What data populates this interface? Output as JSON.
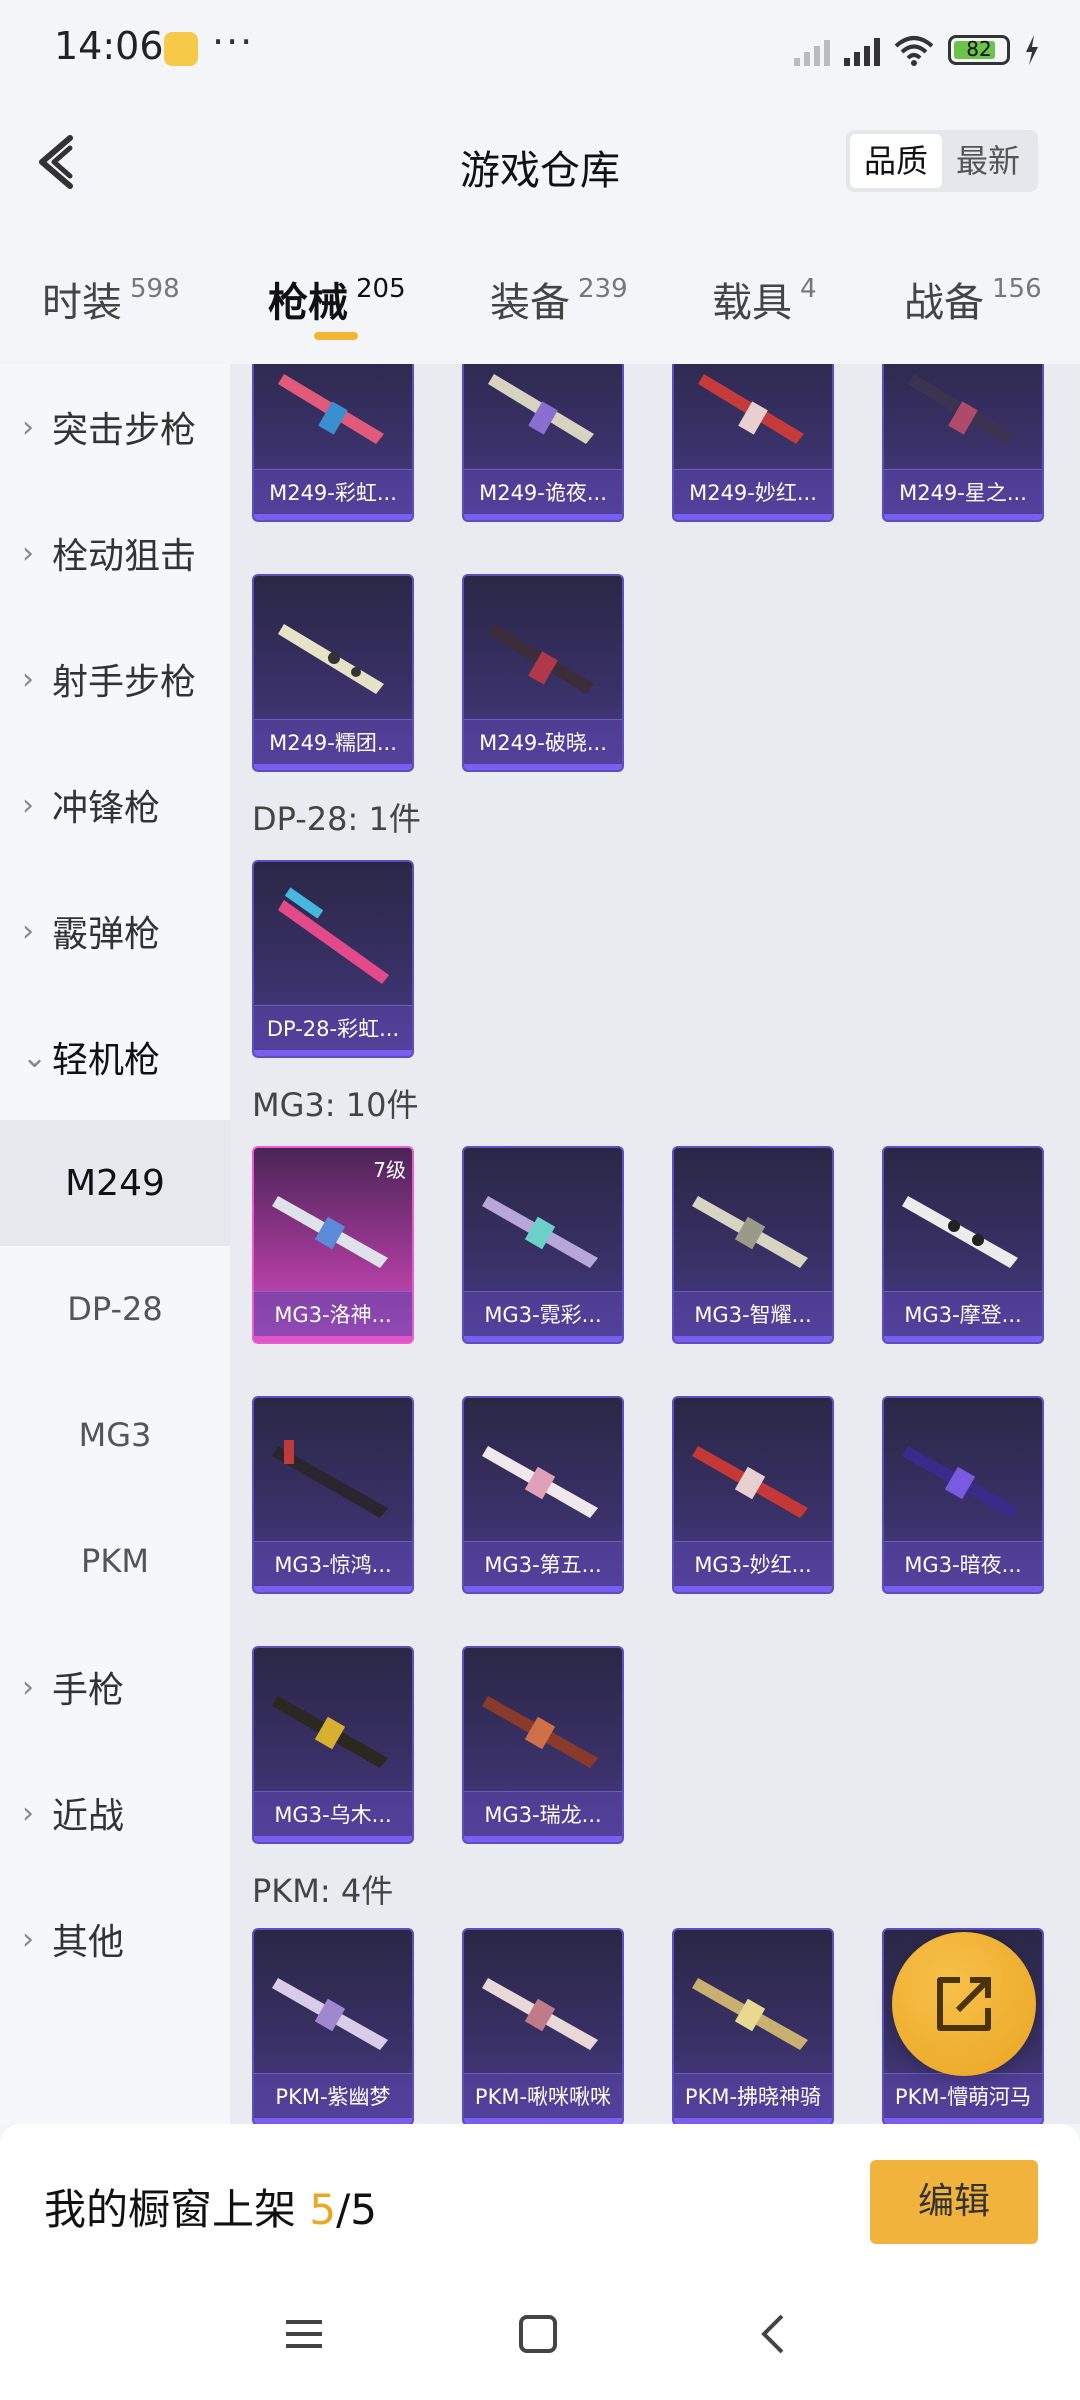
{
  "status": {
    "time": "14:06",
    "battery": "82"
  },
  "header": {
    "title": "游戏仓库",
    "sort_quality": "品质",
    "sort_newest": "最新"
  },
  "tabs": [
    {
      "label": "时装",
      "count": "598"
    },
    {
      "label": "枪械",
      "count": "205"
    },
    {
      "label": "装备",
      "count": "239"
    },
    {
      "label": "载具",
      "count": "4"
    },
    {
      "label": "战备",
      "count": "156"
    }
  ],
  "sidebar": {
    "categories": [
      "突击步枪",
      "栓动狙击",
      "射手步枪",
      "冲锋枪",
      "霰弹枪",
      "轻机枪"
    ],
    "sub": [
      "M249",
      "DP-28",
      "MG3",
      "PKM"
    ],
    "more": [
      "手枪",
      "近战",
      "其他"
    ]
  },
  "sections": {
    "m249_items": [
      "M249-彩虹...",
      "M249-诡夜...",
      "M249-妙红...",
      "M249-星之...",
      "M249-糯团...",
      "M249-破晓..."
    ],
    "dp28_title": "DP-28: 1件",
    "dp28_items": [
      "DP-28-彩虹..."
    ],
    "mg3_title": "MG3: 10件",
    "mg3_items": [
      "MG3-洛神...",
      "MG3-霓彩...",
      "MG3-智耀...",
      "MG3-摩登...",
      "MG3-惊鸿...",
      "MG3-第五...",
      "MG3-妙红...",
      "MG3-暗夜...",
      "MG3-乌木...",
      "MG3-瑞龙..."
    ],
    "mg3_first_level": "7级",
    "pkm_title": "PKM: 4件",
    "pkm_items": [
      "PKM-紫幽梦",
      "PKM-啾咪啾咪",
      "PKM-拂晓神骑",
      "PKM-懵萌河马"
    ]
  },
  "bottom": {
    "label": "我的橱窗上架 ",
    "current": "5",
    "total": "/5",
    "edit": "编辑"
  },
  "colors": {
    "accent": "#f2b33c",
    "card": "#3a3168",
    "card_legendary": "#d850c4"
  }
}
